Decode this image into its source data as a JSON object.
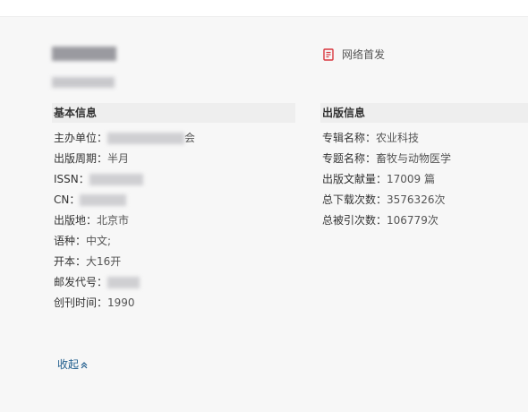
{
  "header": {
    "network_first": "网络首发"
  },
  "basic_info": {
    "title": "基本信息",
    "rows": [
      {
        "label": "主办单位：",
        "value": "",
        "value_suffix": "会",
        "redacted": true
      },
      {
        "label": "出版周期：",
        "value": "半月"
      },
      {
        "label": "ISSN：",
        "value": "",
        "value_suffix": "",
        "redacted": true
      },
      {
        "label": "CN：",
        "value": "",
        "value_suffix": "",
        "redacted": true
      },
      {
        "label": "出版地：",
        "value": "北京市"
      },
      {
        "label": "语种：",
        "value": "中文;"
      },
      {
        "label": "开本：",
        "value": "大16开"
      },
      {
        "label": "邮发代号：",
        "value": "",
        "redacted": true
      },
      {
        "label": "创刊时间：",
        "value": "1990"
      }
    ]
  },
  "publication_info": {
    "title": "出版信息",
    "rows": [
      {
        "label": "专辑名称：",
        "value": "农业科技"
      },
      {
        "label": "专题名称：",
        "value": "畜牧与动物医学"
      },
      {
        "label": "出版文献量：",
        "value": "17009 篇"
      },
      {
        "label": "总下载次数：",
        "value": "3576326次"
      },
      {
        "label": "总被引次数：",
        "value": "106779次"
      }
    ]
  },
  "footer": {
    "collapse_label": "收起"
  },
  "colors": {
    "background": "#f7f7f7",
    "section_header_bg": "#eeeeee",
    "link": "#1e5c8c",
    "icon_red": "#d9363e"
  }
}
